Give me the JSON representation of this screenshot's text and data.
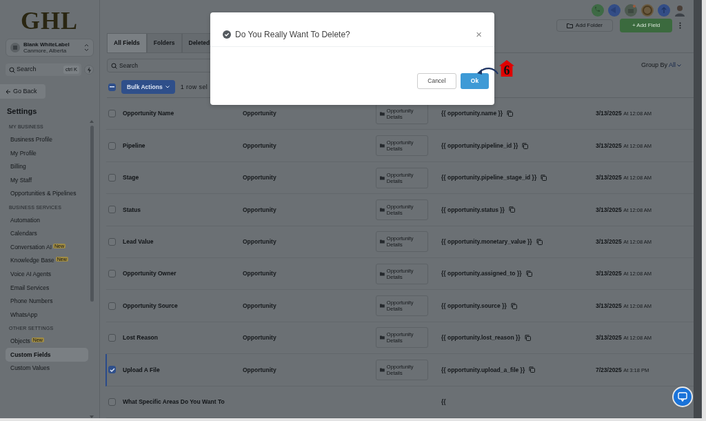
{
  "logo": "GHL",
  "account": {
    "name": "Blank WhiteLabel",
    "location": "Canmore, Alberta"
  },
  "sidebar_search": {
    "placeholder": "Search",
    "shortcut": "ctrl K"
  },
  "go_back": "Go Back",
  "settings_title": "Settings",
  "sidebar_sections": [
    {
      "heading": "MY BUSINESS",
      "items": [
        {
          "label": "Business Profile",
          "selected": false
        },
        {
          "label": "My Profile",
          "selected": false
        },
        {
          "label": "Billing",
          "selected": false
        },
        {
          "label": "My Staff",
          "selected": false
        },
        {
          "label": "Opportunities & Pipelines",
          "selected": false
        }
      ]
    },
    {
      "heading": "BUSINESS SERVICES",
      "items": [
        {
          "label": "Automation",
          "selected": false
        },
        {
          "label": "Calendars",
          "selected": false
        },
        {
          "label": "Conversation AI",
          "selected": false,
          "badge": "New"
        },
        {
          "label": "Knowledge Base",
          "selected": false,
          "badge": "New"
        },
        {
          "label": "Voice AI Agents",
          "selected": false
        },
        {
          "label": "Email Services",
          "selected": false
        },
        {
          "label": "Phone Numbers",
          "selected": false
        },
        {
          "label": "WhatsApp",
          "selected": false
        }
      ]
    },
    {
      "heading": "OTHER SETTINGS",
      "items": [
        {
          "label": "Objects",
          "selected": false,
          "badge": "New"
        },
        {
          "label": "Custom Fields",
          "selected": true
        },
        {
          "label": "Custom Values",
          "selected": false
        }
      ]
    }
  ],
  "actions": {
    "add_folder": "Add Folder",
    "add_field": "+ Add Field"
  },
  "tabs": [
    {
      "label": "All Fields",
      "selected": true
    },
    {
      "label": "Folders",
      "selected": false
    },
    {
      "label": "Deleted",
      "selected": false
    }
  ],
  "search": {
    "placeholder": "Search"
  },
  "group_by": {
    "label": "Group By",
    "value": "All"
  },
  "bulk": {
    "indeterminate": true,
    "button": "Bulk Actions",
    "selection_text": "1 row sel"
  },
  "table": {
    "rows": [
      {
        "name": "Opportunity Name",
        "object": "Opportunity",
        "folder": "Opportunity Details",
        "key": "{{ opportunity.name }}",
        "date": "3/13/2025",
        "time": "At 12:08 AM",
        "selected": false
      },
      {
        "name": "Pipeline",
        "object": "Opportunity",
        "folder": "Opportunity Details",
        "key": "{{ opportunity.pipeline_id }}",
        "date": "3/13/2025",
        "time": "At 12:08 AM",
        "selected": false
      },
      {
        "name": "Stage",
        "object": "Opportunity",
        "folder": "Opportunity Details",
        "key": "{{ opportunity.pipeline_stage_id }}",
        "date": "3/13/2025",
        "time": "At 12:08 AM",
        "selected": false
      },
      {
        "name": "Status",
        "object": "Opportunity",
        "folder": "Opportunity Details",
        "key": "{{ opportunity.status }}",
        "date": "3/13/2025",
        "time": "At 12:08 AM",
        "selected": false
      },
      {
        "name": "Lead Value",
        "object": "Opportunity",
        "folder": "Opportunity Details",
        "key": "{{ opportunity.monetary_value }}",
        "date": "3/13/2025",
        "time": "At 12:08 AM",
        "selected": false
      },
      {
        "name": "Opportunity Owner",
        "object": "Opportunity",
        "folder": "Opportunity Details",
        "key": "{{ opportunity.assigned_to }}",
        "date": "3/13/2025",
        "time": "At 12:08 AM",
        "selected": false
      },
      {
        "name": "Opportunity Source",
        "object": "Opportunity",
        "folder": "Opportunity Details",
        "key": "{{ opportunity.source }}",
        "date": "3/13/2025",
        "time": "At 12:08 AM",
        "selected": false
      },
      {
        "name": "Lost Reason",
        "object": "Opportunity",
        "folder": "Opportunity Details",
        "key": "{{ opportunity.lost_reason }}",
        "date": "3/13/2025",
        "time": "At 12:08 AM",
        "selected": false
      },
      {
        "name": "Upload A File",
        "object": "Opportunity",
        "folder": "Opportunity Details",
        "key": "{{ opportunity.upload_a_file }}",
        "date": "7/23/2025",
        "time": "At 3:18 PM",
        "selected": true
      },
      {
        "name": "What Specific Areas Do You Want To",
        "key": "{{",
        "selected": false
      }
    ]
  },
  "dialog": {
    "title": "Do You Really Want To Delete?",
    "close": "×",
    "cancel": "Cancel",
    "ok": "Ok"
  },
  "annotation": {
    "label": "6"
  }
}
